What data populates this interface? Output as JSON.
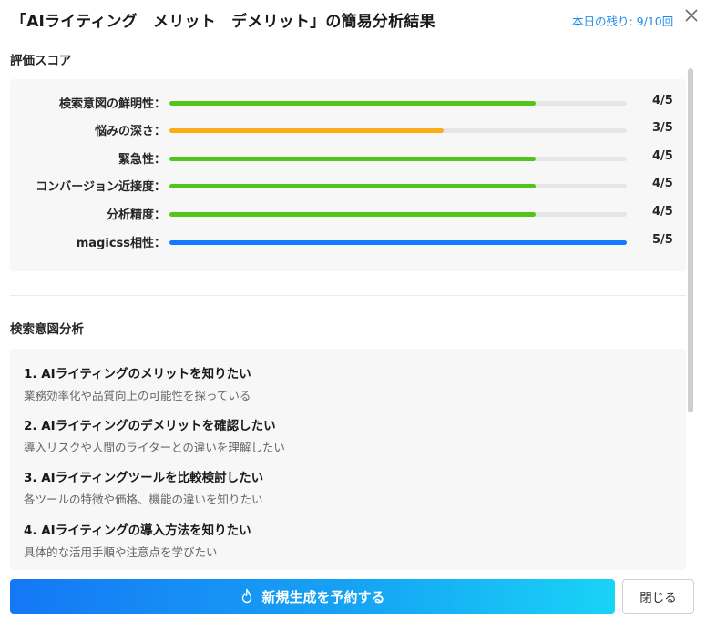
{
  "header": {
    "title": "「AIライティング　メリット　デメリット」の簡易分析結果",
    "remaining": "本日の残り: 9/10回"
  },
  "scores": {
    "heading": "評価スコア",
    "items": [
      {
        "label": "検索意図の鮮明性：",
        "value": "4/5",
        "level": 0.8,
        "color": "#52c41a"
      },
      {
        "label": "悩みの深さ：",
        "value": "3/5",
        "level": 0.6,
        "color": "#faad14"
      },
      {
        "label": "緊急性：",
        "value": "4/5",
        "level": 0.8,
        "color": "#52c41a"
      },
      {
        "label": "コンバージョン近接度：",
        "value": "4/5",
        "level": 0.8,
        "color": "#52c41a"
      },
      {
        "label": "分析精度：",
        "value": "4/5",
        "level": 0.8,
        "color": "#52c41a"
      },
      {
        "label": "magicss相性：",
        "value": "5/5",
        "level": 1.0,
        "color": "#1677ff"
      }
    ]
  },
  "intent": {
    "heading": "検索意図分析",
    "items": [
      {
        "title": "1. AIライティングのメリットを知りたい",
        "desc": "業務効率化や品質向上の可能性を探っている"
      },
      {
        "title": "2. AIライティングのデメリットを確認したい",
        "desc": "導入リスクや人間のライターとの違いを理解したい"
      },
      {
        "title": "3. AIライティングツールを比較検討したい",
        "desc": "各ツールの特徴や価格、機能の違いを知りたい"
      },
      {
        "title": "4. AIライティングの導入方法を知りたい",
        "desc": "具体的な活用手順や注意点を学びたい"
      }
    ]
  },
  "footer": {
    "primary_label": "新規生成を予約する",
    "close_label": "閉じる"
  }
}
